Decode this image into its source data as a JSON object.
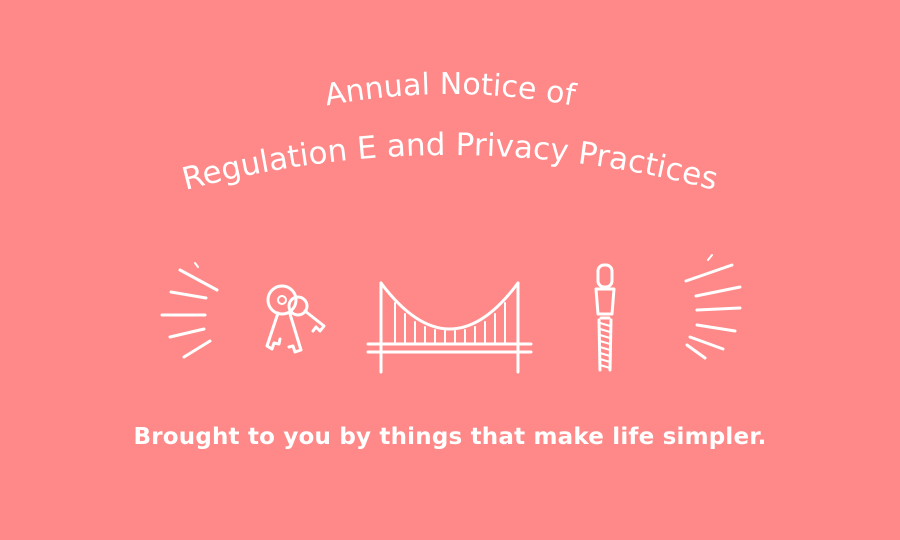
{
  "banner": {
    "title_line_1": "Annual Notice of",
    "title_line_2": "Regulation E and Privacy Practices",
    "tagline": "Brought to you by things that make life simpler.",
    "background_color": "#ff8888",
    "text_color": "#ffffff"
  },
  "icons": [
    "sparkle-left-icon",
    "keys-icon",
    "bridge-icon",
    "zipper-icon",
    "sparkle-right-icon"
  ]
}
